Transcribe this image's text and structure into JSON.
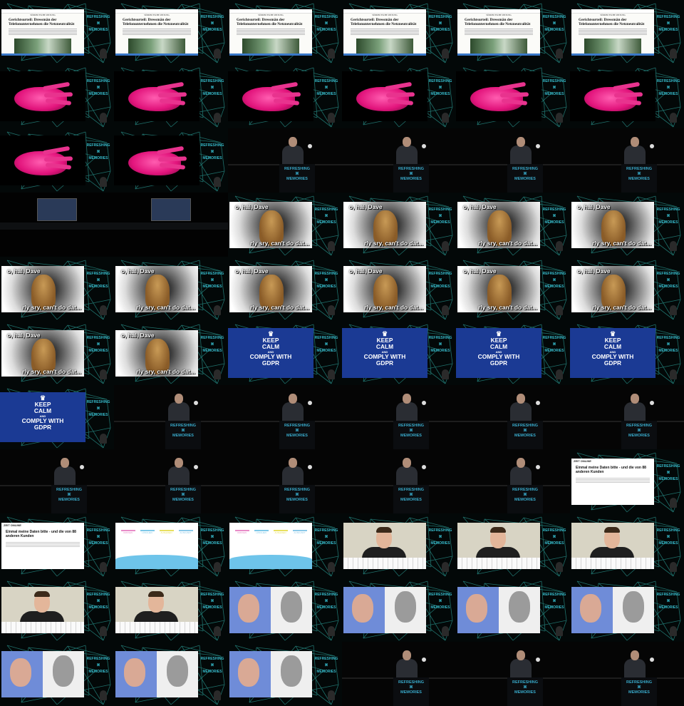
{
  "title": "",
  "grid": {
    "columns": 6,
    "rows": 11
  },
  "stage_logo": {
    "line1": "REFRESHING",
    "line2": "MEMORIES"
  },
  "newspaper": {
    "masthead": "SÜDDEUTSCHE ZEITUNG",
    "headline": "Gerichtsurteil: Dressmän der Telefonunternehmen die Netzneutralität"
  },
  "cat_meme": {
    "top": "o, hai, Dave",
    "bottom": "rly sry, can't do dat..."
  },
  "keep_calm": {
    "line1": "KEEP",
    "line2": "CALM",
    "and": "AND",
    "line3": "COMPLY WITH",
    "line4": "GDPR"
  },
  "online_article": {
    "brand": "ZEIT ONLINE",
    "title": "Einmal meine Daten bitte - und die von 88 anderen Kunden"
  },
  "info_graphic": {
    "cols": [
      "ORDNEN",
      "LÖSCHEN",
      "AUSLESEN",
      "AUSKUNFT"
    ]
  },
  "faces_caption": "",
  "frames": [
    "paper",
    "paper",
    "paper",
    "paper",
    "paper",
    "paper",
    "hand",
    "hand",
    "hand",
    "hand",
    "hand",
    "hand",
    "hand",
    "hand",
    "podium",
    "podium",
    "podium",
    "podium",
    "hall",
    "hall",
    "cat",
    "cat",
    "cat",
    "cat",
    "cat",
    "cat",
    "cat",
    "cat",
    "cat",
    "cat",
    "cat",
    "cat",
    "calm",
    "calm",
    "calm",
    "calm",
    "calm",
    "podium",
    "podium",
    "podium",
    "podium",
    "podium",
    "podium",
    "podium",
    "podium",
    "podium",
    "podium",
    "online",
    "online",
    "info",
    "info",
    "portrait",
    "portrait",
    "portrait",
    "portrait",
    "portrait",
    "faces",
    "faces",
    "faces",
    "faces",
    "faces",
    "faces",
    "faces",
    "podium",
    "podium",
    "podium"
  ]
}
